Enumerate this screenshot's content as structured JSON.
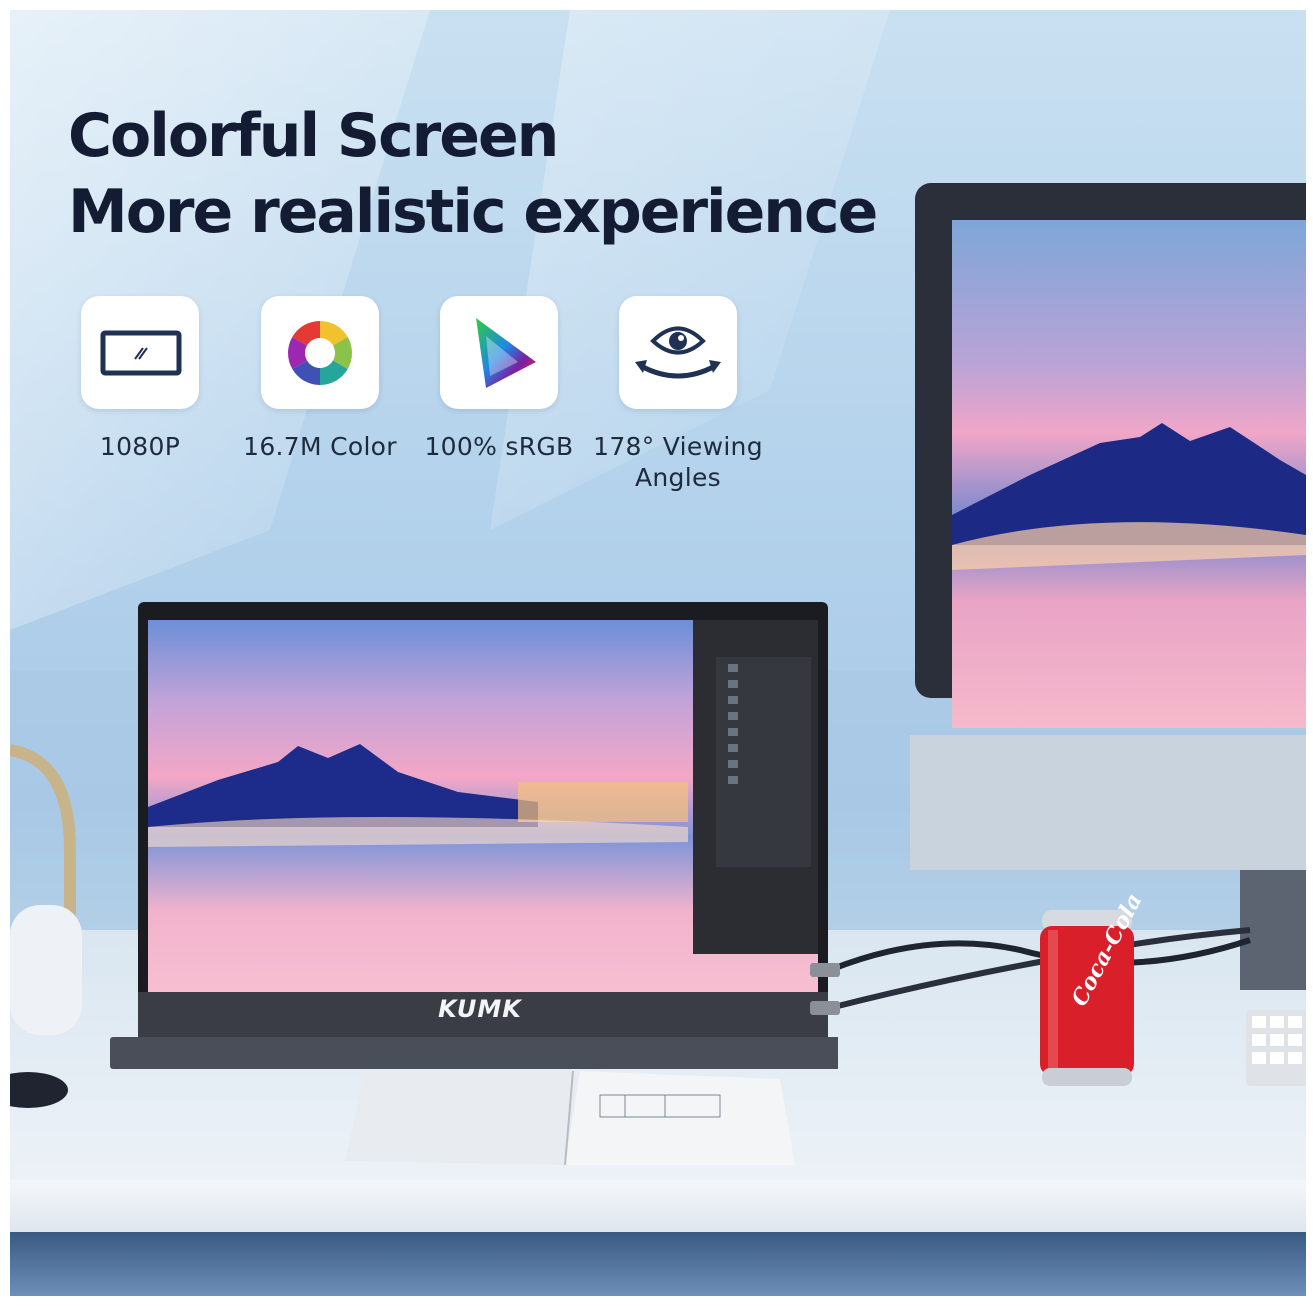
{
  "headline": {
    "line1": "Colorful Screen",
    "line2": "More realistic experience"
  },
  "features": [
    {
      "icon": "screen-resolution-icon",
      "label": "1080P"
    },
    {
      "icon": "color-wheel-icon",
      "label": "16.7M Color"
    },
    {
      "icon": "srgb-gamut-icon",
      "label": "100% sRGB"
    },
    {
      "icon": "viewing-angle-eye-icon",
      "label": "178° Viewing Angles"
    }
  ],
  "monitor_brand": "KUMK",
  "can_brand": "Coca-Cola",
  "colors": {
    "headline": "#141c33",
    "tile_bg": "#ffffff",
    "label_text": "#1e2b3d",
    "can_red": "#d9202a"
  }
}
